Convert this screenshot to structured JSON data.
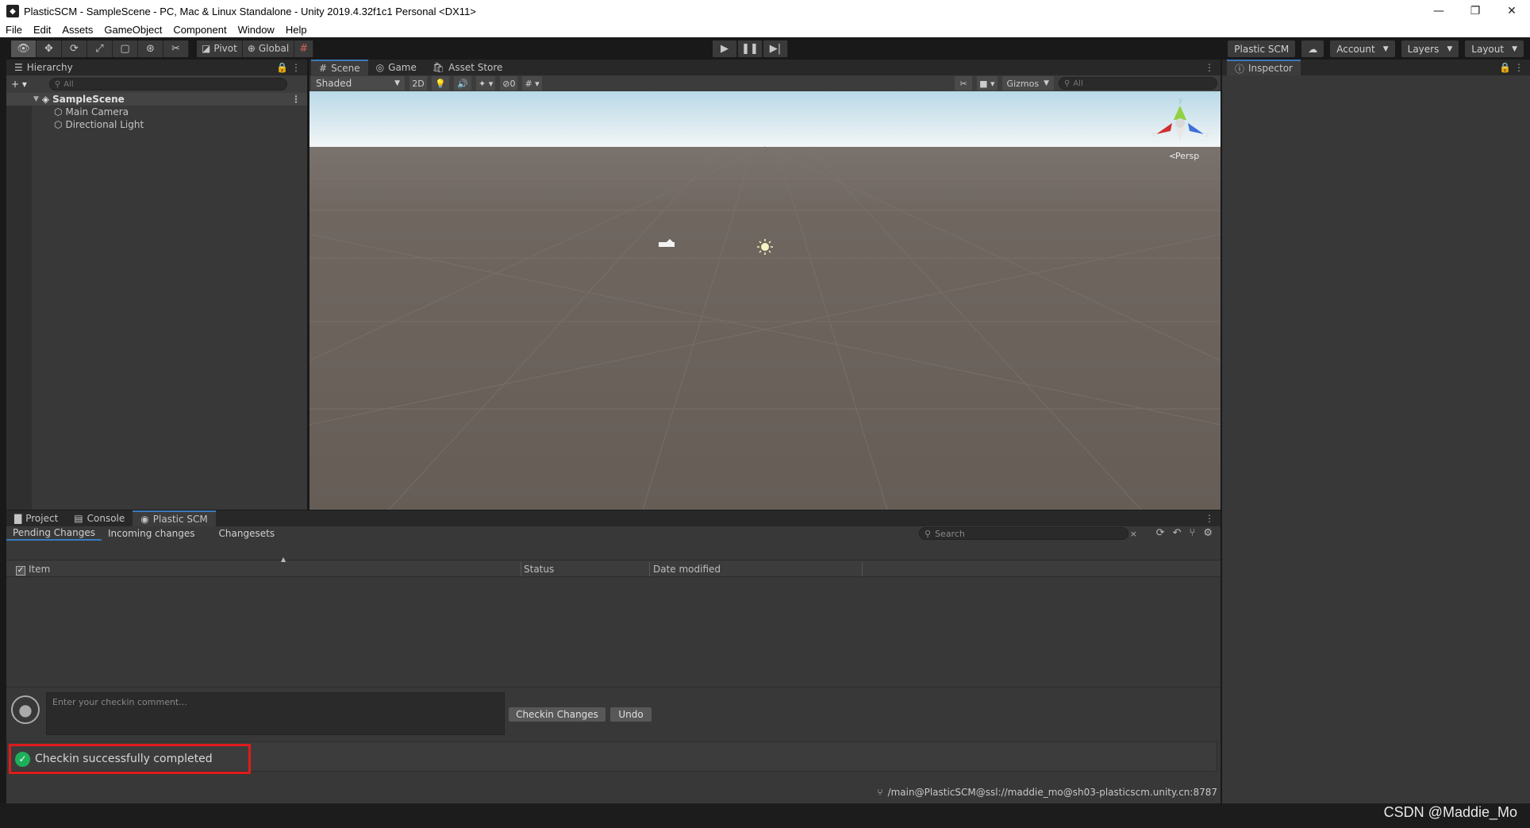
{
  "window": {
    "title": "PlasticSCM - SampleScene - PC, Mac & Linux Standalone - Unity 2019.4.32f1c1 Personal <DX11>",
    "controls": [
      "—",
      "❐",
      "✕"
    ]
  },
  "menu": [
    "File",
    "Edit",
    "Assets",
    "GameObject",
    "Component",
    "Window",
    "Help"
  ],
  "toolbar": {
    "pivot_label": "Pivot",
    "global_label": "Global",
    "plastic_label": "Plastic SCM",
    "account_label": "Account",
    "layers_label": "Layers",
    "layout_label": "Layout"
  },
  "hierarchy": {
    "tab_label": "Hierarchy",
    "search_placeholder": "All",
    "scene_name": "SampleScene",
    "objects": [
      "Main Camera",
      "Directional Light"
    ]
  },
  "scene": {
    "tabs": [
      "Scene",
      "Game",
      "Asset Store"
    ],
    "shading": "Shaded",
    "mode_2d": "2D",
    "hidden_count": "0",
    "gizmos_label": "Gizmos",
    "search_placeholder": "All",
    "persp_label": "Persp",
    "axis_x": "x",
    "axis_y": "y",
    "axis_z": "z"
  },
  "inspector": {
    "tab_label": "Inspector"
  },
  "bottom": {
    "tabs": [
      "Project",
      "Console",
      "Plastic SCM"
    ],
    "subtabs": [
      "Pending Changes",
      "Incoming changes",
      "Changesets"
    ],
    "search_placeholder": "Search",
    "columns": [
      "Item",
      "Status",
      "Date modified"
    ],
    "comment_placeholder": "Enter your checkin comment...",
    "checkin_button": "Checkin Changes",
    "undo_button": "Undo",
    "notification": "Checkin successfully completed",
    "branch": "/main@PlasticSCM@ssl://maddie_mo@sh03-plasticscm.unity.cn:8787"
  },
  "watermark": "CSDN @Maddie_Mo",
  "colors": {
    "accent": "#3a79bb",
    "success": "#1db05b",
    "highlight_border": "#e01b1b",
    "sky": "#d6ebf5",
    "ground": "#6b625c"
  }
}
